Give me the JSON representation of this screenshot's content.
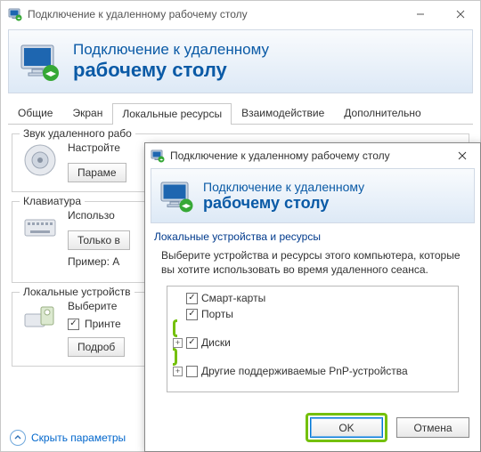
{
  "win1": {
    "title": "Подключение к удаленному рабочему столу",
    "banner_line1": "Подключение к удаленному",
    "banner_line2": "рабочему столу",
    "tabs": [
      "Общие",
      "Экран",
      "Локальные ресурсы",
      "Взаимодействие",
      "Дополнительно"
    ],
    "active_tab": 2,
    "group_audio": {
      "legend": "Звук удаленного рабо",
      "text": "Настройте",
      "button": "Параме"
    },
    "group_keyboard": {
      "legend": "Клавиатура",
      "text": "Использо",
      "button": "Только в",
      "hint": "Пример: A"
    },
    "group_devices": {
      "legend": "Локальные устройств",
      "text": "Выберите",
      "check_printers": "Принте",
      "button": "Подроб"
    },
    "footer": "Скрыть параметры"
  },
  "win2": {
    "title": "Подключение к удаленному рабочему столу",
    "banner_line1": "Подключение к удаленному",
    "banner_line2": "рабочему столу",
    "group_label": "Локальные устройства и ресурсы",
    "group_desc": "Выберите устройства и ресурсы этого компьютера, которые вы хотите использовать во время удаленного сеанса.",
    "tree": {
      "smartcards": {
        "label": "Смарт-карты",
        "checked": true
      },
      "ports": {
        "label": "Порты",
        "checked": true
      },
      "drives": {
        "label": "Диски",
        "checked": true
      },
      "pnp": {
        "label": "Другие поддерживаемые PnP-устройства",
        "checked": false
      }
    },
    "buttons": {
      "ok": "OK",
      "cancel": "Отмена"
    }
  }
}
